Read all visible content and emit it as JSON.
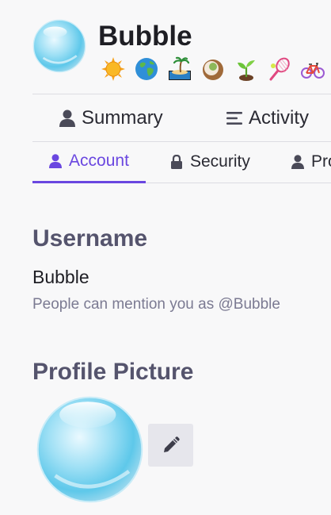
{
  "profile": {
    "display_name": "Bubble",
    "emoji_badges": [
      {
        "icon": "sun-icon"
      },
      {
        "icon": "globe-icon"
      },
      {
        "icon": "desert-island-icon"
      },
      {
        "icon": "coconut-icon"
      },
      {
        "icon": "seedling-icon"
      },
      {
        "icon": "tennis-icon"
      },
      {
        "icon": "bicycle-icon"
      }
    ]
  },
  "primary_nav": {
    "summary": "Summary",
    "activity": "Activity"
  },
  "tabs": {
    "account": "Account",
    "security": "Security",
    "profile": "Pro",
    "active": "account"
  },
  "account": {
    "username_heading": "Username",
    "username": "Bubble",
    "mention_hint": "People can mention you as @Bubble",
    "profile_picture_heading": "Profile Picture"
  },
  "colors": {
    "accent": "#6a47e0",
    "heading": "#55546d",
    "muted": "#7b7a92",
    "button_bg": "#e6e6ec"
  }
}
